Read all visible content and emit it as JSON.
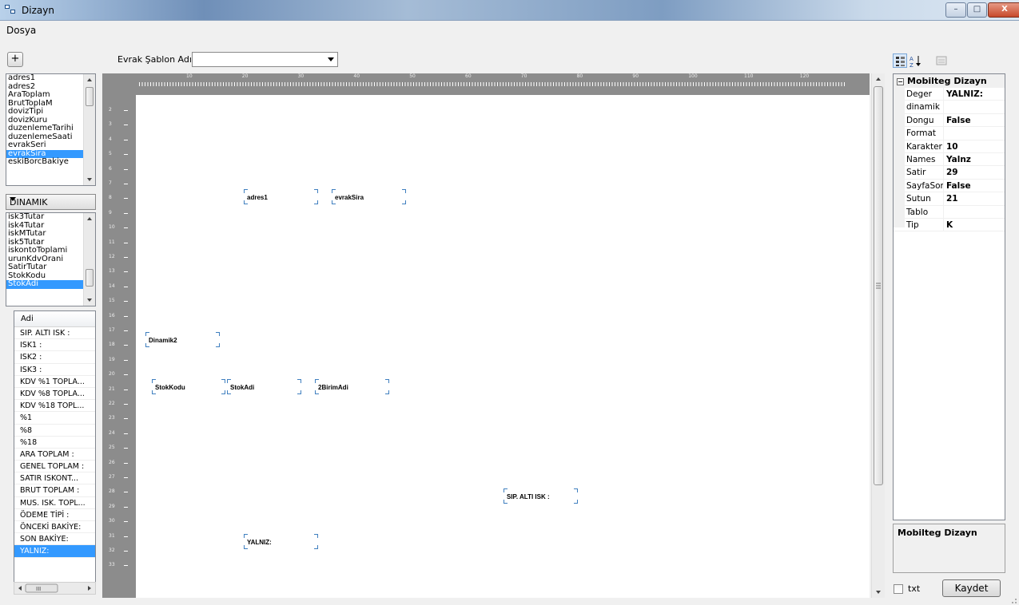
{
  "window": {
    "title": "Dizayn",
    "controls": {
      "minimize": "–",
      "maximize": "□",
      "close": "X"
    }
  },
  "menu": {
    "items": [
      "Dosya"
    ]
  },
  "toolbar": {
    "add_label": "+",
    "template_label": "Evrak Şablon Adı",
    "template_value": ""
  },
  "fields_list": {
    "items": [
      "adres1",
      "adres2",
      "AraToplam",
      "BrutToplaM",
      "dovizTipi",
      "dovizKuru",
      "duzenlemeTarihi",
      "duzenlemeSaati",
      "evrakSeri",
      "evrakSira",
      "eskiBorcBakiye"
    ],
    "selected": "evrakSira"
  },
  "type_combo": {
    "value": "DINAMIK"
  },
  "dynamic_list": {
    "items": [
      "isk3Tutar",
      "isk4Tutar",
      "iskMTutar",
      "isk5Tutar",
      "iskontoToplami",
      "urunKdvOrani",
      "SatirTutar",
      "StokKodu",
      "StokAdi"
    ],
    "selected": "StokAdi"
  },
  "labels_grid": {
    "header": "Adi",
    "rows": [
      "SIP. ALTI ISK :",
      "ISK1 :",
      "ISK2 :",
      "ISK3 :",
      "KDV %1 TOPLA...",
      "KDV %8 TOPLA...",
      "KDV %18 TOPL...",
      "%1",
      "%8",
      "%18",
      "ARA TOPLAM :",
      "GENEL TOPLAM :",
      "SATIR ISKONT...",
      "BRUT TOPLAM :",
      "MUS. ISK. TOPL...",
      "ÖDEME TİPİ :",
      "ÖNCEKİ BAKİYE:",
      "SON BAKİYE:",
      "YALNIZ:"
    ],
    "selected": "YALNIZ:"
  },
  "ruler": {
    "top_labels": [
      "10",
      "20",
      "30",
      "40",
      "50",
      "60",
      "70",
      "80",
      "90",
      "100",
      "110",
      "120"
    ],
    "left_labels": [
      "2",
      "3",
      "4",
      "5",
      "6",
      "7",
      "8",
      "9",
      "10",
      "11",
      "12",
      "13",
      "14",
      "15",
      "16",
      "17",
      "18",
      "19",
      "20",
      "21",
      "22",
      "23",
      "24",
      "25",
      "26",
      "27",
      "28",
      "29",
      "30",
      "31",
      "32",
      "33"
    ]
  },
  "design_fields": [
    {
      "label": "adres1"
    },
    {
      "label": "evrakSira"
    },
    {
      "label": "Dinamik2"
    },
    {
      "label": "StokKodu"
    },
    {
      "label": "StokAdi"
    },
    {
      "label": "2BirimAdi"
    },
    {
      "label": "SIP. ALTI ISK :"
    },
    {
      "label": "YALNIZ:"
    }
  ],
  "property_grid": {
    "category": "Mobilteg Dizayn",
    "properties": [
      {
        "name": "Deger",
        "value": "YALNIZ:"
      },
      {
        "name": "dinamik",
        "value": ""
      },
      {
        "name": "Dongu",
        "value": "False"
      },
      {
        "name": "Format",
        "value": ""
      },
      {
        "name": "Karakter",
        "value": "10"
      },
      {
        "name": "Names",
        "value": "Yalnz"
      },
      {
        "name": "Satir",
        "value": "29"
      },
      {
        "name": "SayfaSonu",
        "value": "False"
      },
      {
        "name": "Sutun",
        "value": "21"
      },
      {
        "name": "Tablo",
        "value": ""
      },
      {
        "name": "Tip",
        "value": "K"
      }
    ],
    "description_title": "Mobilteg Dizayn"
  },
  "footer": {
    "txt_label": "txt",
    "txt_checked": false,
    "save_label": "Kaydet"
  }
}
